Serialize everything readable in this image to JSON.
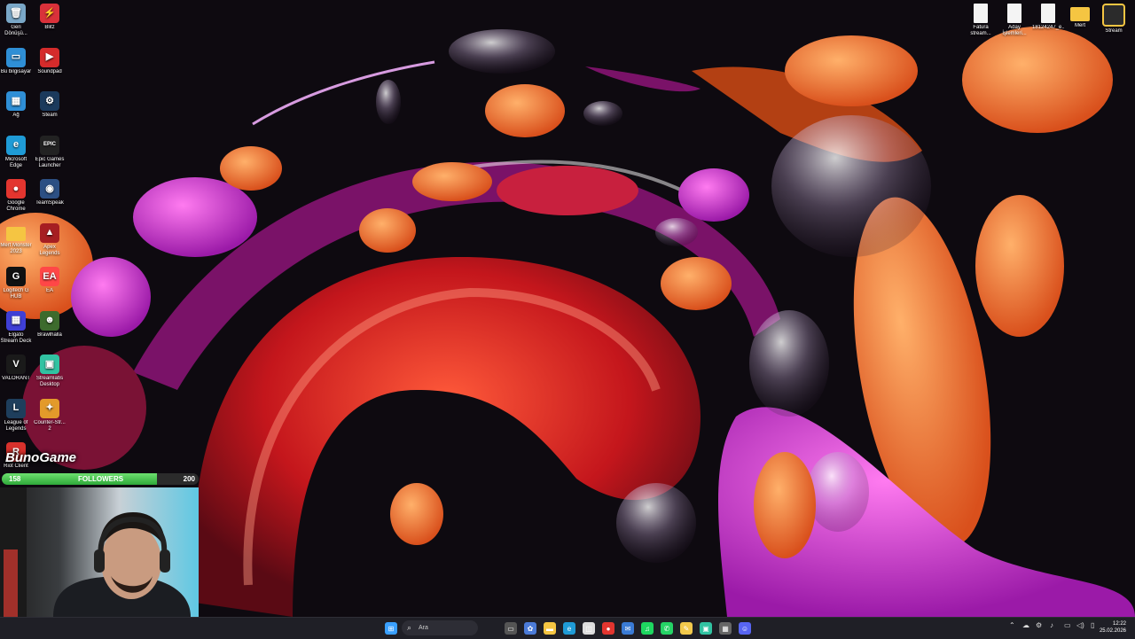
{
  "desktop_icons_left": [
    {
      "label": "Geri Dönüşü...",
      "icon": "recycle-bin-icon",
      "color": "#7aa7c7",
      "glyph": "🗑"
    },
    {
      "label": "Blitz",
      "icon": "blitz-icon",
      "color": "#d9313a",
      "glyph": "⚡"
    },
    {
      "label": "Bu bilgisayar",
      "icon": "computer-icon",
      "color": "#2f8fd6",
      "glyph": "▭"
    },
    {
      "label": "Soundpad",
      "icon": "soundpad-icon",
      "color": "#d52b2b",
      "glyph": "▶"
    },
    {
      "label": "Ağ",
      "icon": "network-icon",
      "color": "#2f8fd6",
      "glyph": "▦"
    },
    {
      "label": "Steam",
      "icon": "steam-icon",
      "color": "#1b3a5c",
      "glyph": "⚙"
    },
    {
      "label": "Microsoft Edge",
      "icon": "edge-icon",
      "color": "#1f9bd6",
      "glyph": "e"
    },
    {
      "label": "Epic Games Launcher",
      "icon": "epic-games-icon",
      "color": "#222222",
      "glyph": "EPIC"
    },
    {
      "label": "Google Chrome",
      "icon": "chrome-icon",
      "color": "#e3352f",
      "glyph": "●"
    },
    {
      "label": "TeamSpeak",
      "icon": "teamspeak-icon",
      "color": "#2c4f83",
      "glyph": "◉"
    },
    {
      "label": "Mert Monster 2023",
      "icon": "folder-icon",
      "color": "#f5c542",
      "glyph": ""
    },
    {
      "label": "Apex Legends",
      "icon": "apex-icon",
      "color": "#a61e22",
      "glyph": "▲"
    },
    {
      "label": "Logitech G HUB",
      "icon": "logitech-icon",
      "color": "#111111",
      "glyph": "G"
    },
    {
      "label": "EA",
      "icon": "ea-icon",
      "color": "#ff4747",
      "glyph": "EA"
    },
    {
      "label": "Elgato Stream Deck",
      "icon": "stream-deck-icon",
      "color": "#3f3fd6",
      "glyph": "▦"
    },
    {
      "label": "Brawlhalla",
      "icon": "brawlhalla-icon",
      "color": "#3d6b2d",
      "glyph": "☻"
    },
    {
      "label": "VALORANT",
      "icon": "valorant-icon",
      "color": "#1a1a1a",
      "glyph": "V"
    },
    {
      "label": "Streamlabs Desktop",
      "icon": "streamlabs-icon",
      "color": "#31c3a2",
      "glyph": "▣"
    },
    {
      "label": "League of Legends",
      "icon": "league-icon",
      "color": "#1e3e5c",
      "glyph": "L"
    },
    {
      "label": "Counter-Str... 2",
      "icon": "cs2-icon",
      "color": "#e39a2a",
      "glyph": "✦"
    },
    {
      "label": "Riot Client",
      "icon": "riot-icon",
      "color": "#d8312c",
      "glyph": "R"
    }
  ],
  "desktop_icons_right": [
    {
      "label": "Fatura stream...",
      "icon": "document-icon"
    },
    {
      "label": "Aday İşlemleri...",
      "icon": "document-icon"
    },
    {
      "label": "18124247_e...",
      "icon": "document-icon"
    },
    {
      "label": "Mert",
      "icon": "folder-icon"
    },
    {
      "label": "Stream",
      "icon": "stream-folder-icon"
    }
  ],
  "overlay": {
    "brand": "BunoGame",
    "followers_current": "158",
    "followers_label": "FOLLOWERS",
    "followers_goal": "200",
    "followers_progress": 0.79
  },
  "taskbar": {
    "search_placeholder": "Ara",
    "clock_time": "12:22",
    "clock_date": "25.02.2026",
    "apps": [
      {
        "name": "start-icon",
        "color": "#3aa0ff",
        "glyph": "⊞"
      },
      {
        "name": "task-view-icon",
        "color": "#555",
        "glyph": "▭"
      },
      {
        "name": "copilot-icon",
        "color": "#4b7bd8",
        "glyph": "✿"
      },
      {
        "name": "file-explorer-icon",
        "color": "#f5c542",
        "glyph": "▬"
      },
      {
        "name": "edge-icon",
        "color": "#1f9bd6",
        "glyph": "e"
      },
      {
        "name": "store-icon",
        "color": "#ddd",
        "glyph": "◫"
      },
      {
        "name": "chrome-icon",
        "color": "#e3352f",
        "glyph": "●"
      },
      {
        "name": "mail-icon",
        "color": "#3a7bd5",
        "glyph": "✉"
      },
      {
        "name": "spotify-icon",
        "color": "#1ed760",
        "glyph": "♫"
      },
      {
        "name": "whatsapp-icon",
        "color": "#25d366",
        "glyph": "✆"
      },
      {
        "name": "notes-icon",
        "color": "#f2c94c",
        "glyph": "✎"
      },
      {
        "name": "streamlabs-icon",
        "color": "#31c3a2",
        "glyph": "▣"
      },
      {
        "name": "calculator-icon",
        "color": "#666",
        "glyph": "▦"
      },
      {
        "name": "discord-icon",
        "color": "#5865f2",
        "glyph": "☺"
      }
    ]
  }
}
